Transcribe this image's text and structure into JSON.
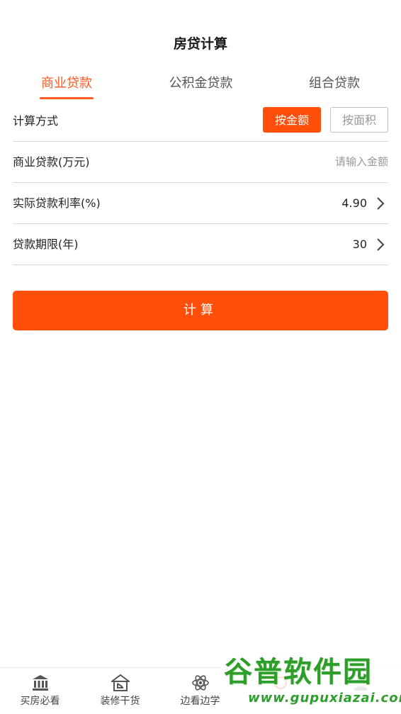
{
  "header": {
    "title": "房贷计算"
  },
  "tabs": [
    {
      "label": "商业贷款",
      "active": true
    },
    {
      "label": "公积金贷款",
      "active": false
    },
    {
      "label": "组合贷款",
      "active": false
    }
  ],
  "form": {
    "method": {
      "label": "计算方式",
      "options": [
        {
          "label": "按金额",
          "selected": true
        },
        {
          "label": "按面积",
          "selected": false
        }
      ]
    },
    "amount": {
      "label": "商业贷款(万元)",
      "value": "",
      "placeholder": "请输入金额"
    },
    "rate": {
      "label": "实际贷款利率(%)",
      "value": "4.90"
    },
    "term": {
      "label": "贷款期限(年)",
      "value": "30"
    }
  },
  "calculate_button": {
    "label": "计算"
  },
  "bottom_nav": {
    "items": [
      {
        "label": "买房必看",
        "icon": "bank-icon"
      },
      {
        "label": "装修干货",
        "icon": "house-icon"
      },
      {
        "label": "边看边学",
        "icon": "atom-icon"
      },
      {
        "label": "",
        "icon": "tool-icon"
      },
      {
        "label": "",
        "icon": "user-icon"
      }
    ]
  },
  "watermark": {
    "text": "谷普软件园",
    "url": "www.gupuxiazai.com"
  },
  "colors": {
    "accent": "#ff4f0a",
    "tab_active": "#ff5a1f",
    "divider": "#d9d9d9",
    "watermark": "#2e9e2a"
  }
}
